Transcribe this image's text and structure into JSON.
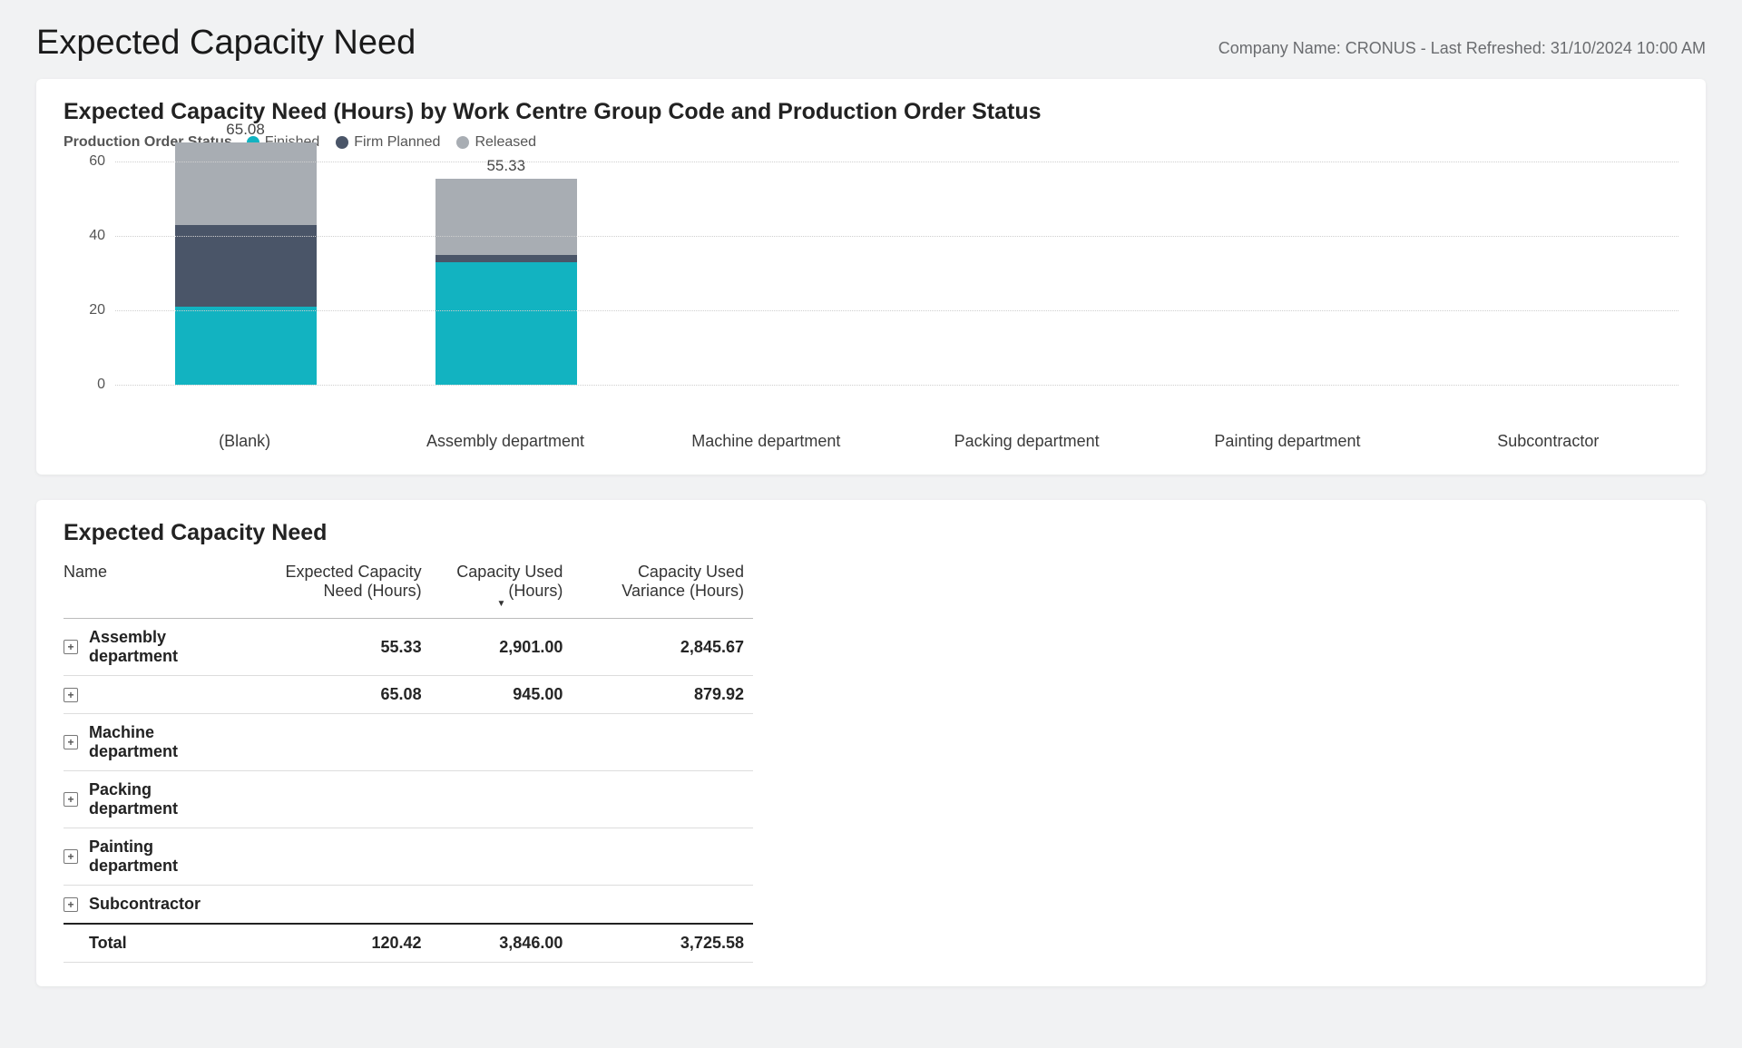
{
  "header": {
    "title": "Expected Capacity Need",
    "status": "Company Name: CRONUS - Last Refreshed: 31/10/2024 10:00 AM"
  },
  "chart_card": {
    "title": "Expected Capacity Need (Hours) by Work Centre Group Code and Production Order Status",
    "legend_title": "Production Order Status",
    "legend": [
      {
        "name": "Finished",
        "color": "#12b3c1"
      },
      {
        "name": "Firm Planned",
        "color": "#4a5568"
      },
      {
        "name": "Released",
        "color": "#a8adb3"
      }
    ]
  },
  "chart_data": {
    "type": "bar",
    "stacked": true,
    "ylabel": "",
    "xlabel": "",
    "ylim": [
      0,
      60
    ],
    "yticks": [
      0,
      20,
      40,
      60
    ],
    "categories": [
      "(Blank)",
      "Assembly department",
      "Machine department",
      "Packing department",
      "Painting department",
      "Subcontractor"
    ],
    "series": [
      {
        "name": "Finished",
        "color": "#12b3c1",
        "values": [
          21,
          33,
          0,
          0,
          0,
          0
        ]
      },
      {
        "name": "Firm Planned",
        "color": "#4a5568",
        "values": [
          22,
          2,
          0,
          0,
          0,
          0
        ]
      },
      {
        "name": "Released",
        "color": "#a8adb3",
        "values": [
          22.08,
          20.33,
          0,
          0,
          0,
          0
        ]
      }
    ],
    "totals": [
      "65.08",
      "55.33",
      "",
      "",
      "",
      ""
    ]
  },
  "table_card": {
    "title": "Expected Capacity Need",
    "columns": [
      "Name",
      "Expected Capacity Need (Hours)",
      "Capacity Used (Hours)",
      "Capacity Used Variance (Hours)"
    ],
    "sorted_column_index": 2,
    "rows": [
      {
        "name": "Assembly department",
        "v1": "55.33",
        "v2": "2,901.00",
        "v3": "2,845.67"
      },
      {
        "name": "",
        "v1": "65.08",
        "v2": "945.00",
        "v3": "879.92"
      },
      {
        "name": "Machine department",
        "v1": "",
        "v2": "",
        "v3": ""
      },
      {
        "name": "Packing department",
        "v1": "",
        "v2": "",
        "v3": ""
      },
      {
        "name": "Painting department",
        "v1": "",
        "v2": "",
        "v3": ""
      },
      {
        "name": "Subcontractor",
        "v1": "",
        "v2": "",
        "v3": ""
      }
    ],
    "total": {
      "label": "Total",
      "v1": "120.42",
      "v2": "3,846.00",
      "v3": "3,725.58"
    }
  }
}
